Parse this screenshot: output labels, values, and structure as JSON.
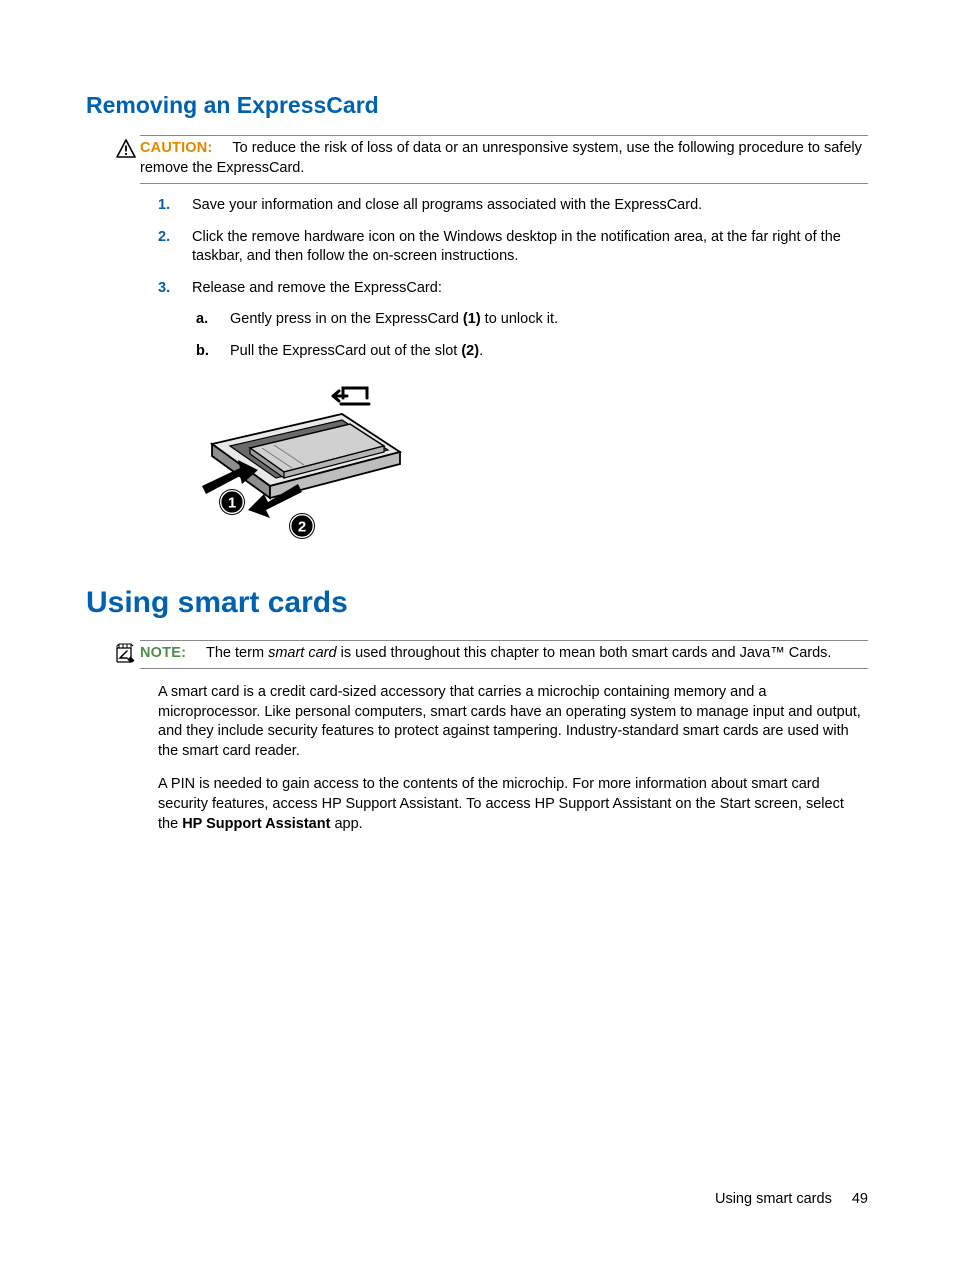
{
  "section1": {
    "heading": "Removing an ExpressCard",
    "caution_label": "CAUTION:",
    "caution_text": "To reduce the risk of loss of data or an unresponsive system, use the following procedure to safely remove the ExpressCard.",
    "steps": {
      "s1_num": "1.",
      "s1_text": "Save your information and close all programs associated with the ExpressCard.",
      "s2_num": "2.",
      "s2_text": "Click the remove hardware icon on the Windows desktop in the notification area, at the far right of the taskbar, and then follow the on-screen instructions.",
      "s3_num": "3.",
      "s3_text": "Release and remove the ExpressCard:",
      "s3a_letter": "a.",
      "s3a_pre": "Gently press in on the ExpressCard ",
      "s3a_bold": "(1)",
      "s3a_post": " to unlock it.",
      "s3b_letter": "b.",
      "s3b_pre": "Pull the ExpressCard out of the slot ",
      "s3b_bold": "(2)",
      "s3b_post": "."
    }
  },
  "section2": {
    "heading": "Using smart cards",
    "note_label": "NOTE:",
    "note_pre": "The term ",
    "note_em": "smart card",
    "note_post": " is used throughout this chapter to mean both smart cards and Java™ Cards.",
    "para1": "A smart card is a credit card-sized accessory that carries a microchip containing memory and a microprocessor. Like personal computers, smart cards have an operating system to manage input and output, and they include security features to protect against tampering. Industry-standard smart cards are used with the smart card reader.",
    "para2_pre": "A PIN is needed to gain access to the contents of the microchip. For more information about smart card security features, access HP Support Assistant. To access HP Support Assistant on the Start screen, select the ",
    "para2_bold": "HP Support Assistant",
    "para2_post": " app."
  },
  "footer": {
    "label": "Using smart cards",
    "page": "49"
  }
}
